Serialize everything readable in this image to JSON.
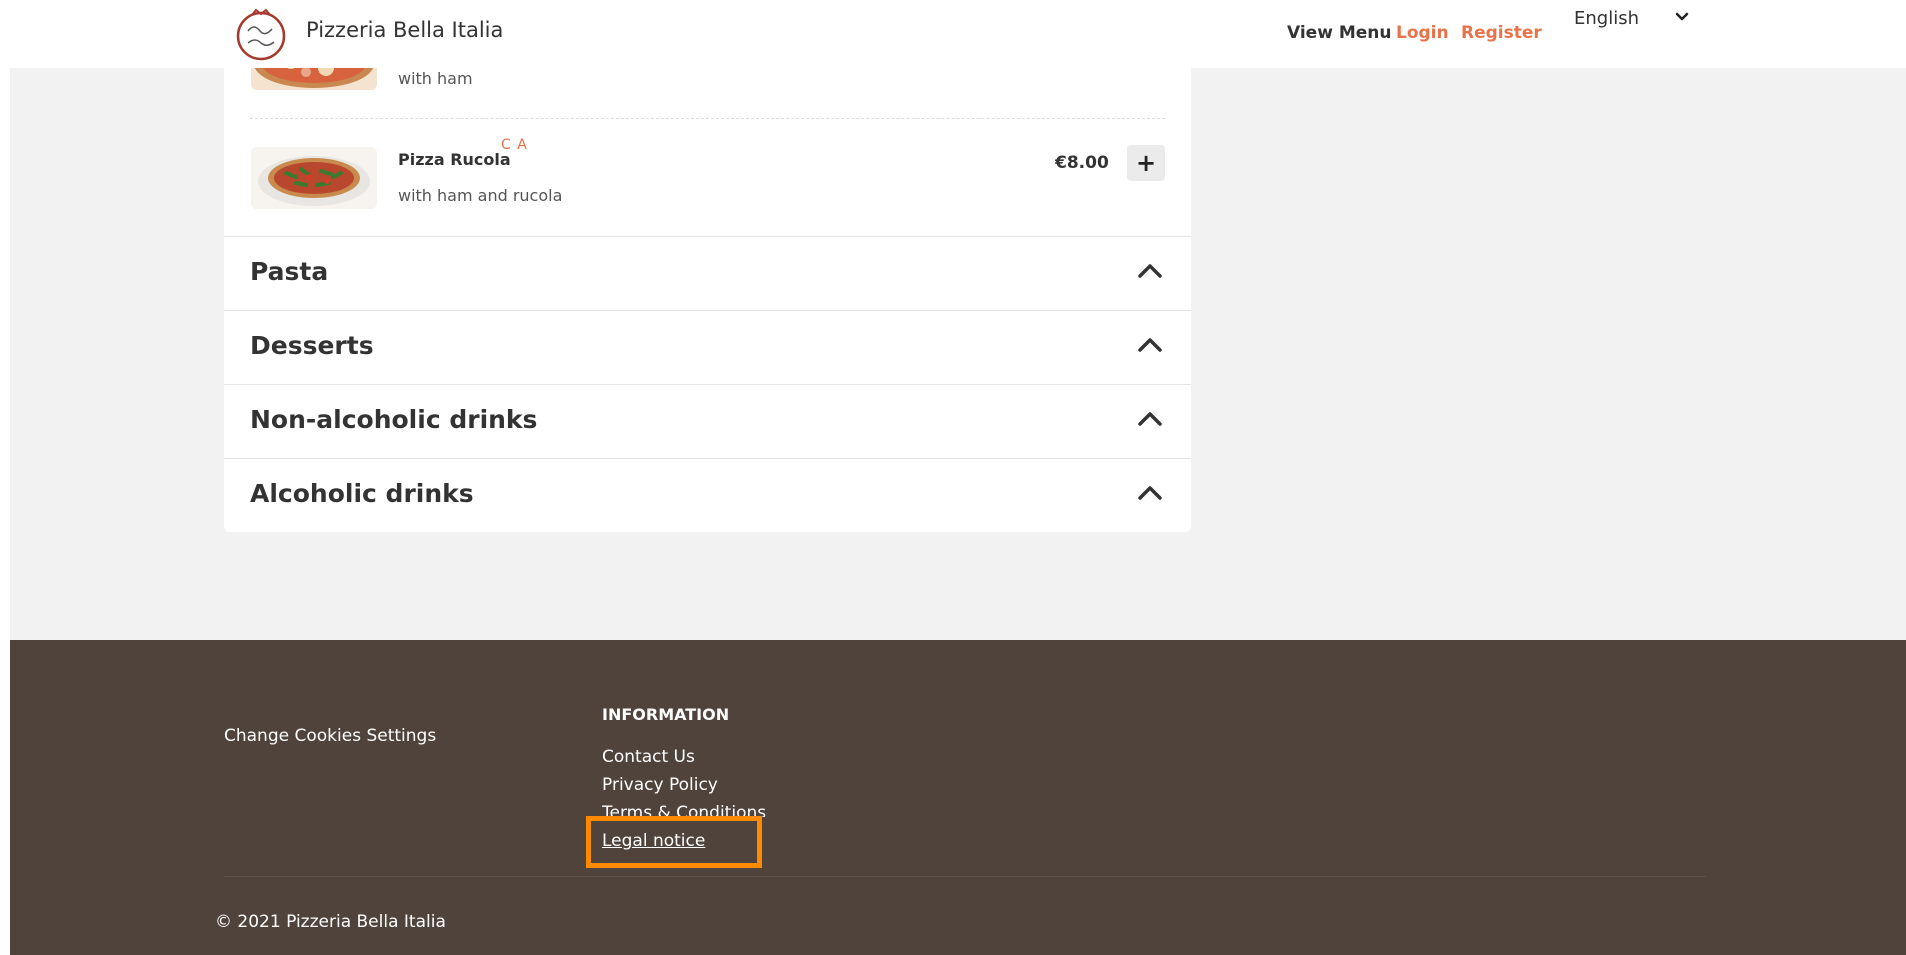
{
  "header": {
    "brand": "Pizzeria Bella Italia",
    "nav": {
      "view_menu": "View Menu",
      "login": "Login",
      "register": "Register"
    },
    "language": "English",
    "accent_color": "#e8734a"
  },
  "menu": {
    "items": [
      {
        "name": "",
        "description": "with ham",
        "tags": "",
        "price": ""
      },
      {
        "name": "Pizza Rucola",
        "description": "with ham and rucola",
        "tags": "C A",
        "price": "€8.00",
        "add_label": "+"
      }
    ],
    "categories": [
      {
        "title": "Pasta"
      },
      {
        "title": "Desserts"
      },
      {
        "title": "Non-alcoholic drinks"
      },
      {
        "title": "Alcoholic drinks"
      }
    ]
  },
  "footer": {
    "cookies": "Change Cookies Settings",
    "information_title": "INFORMATION",
    "links": [
      "Contact Us",
      "Privacy Policy",
      "Terms & Conditions",
      "Legal notice"
    ],
    "copyright": "© 2021 Pizzeria Bella Italia",
    "background_color": "#4f433b",
    "highlight_color": "#ff8a00"
  }
}
